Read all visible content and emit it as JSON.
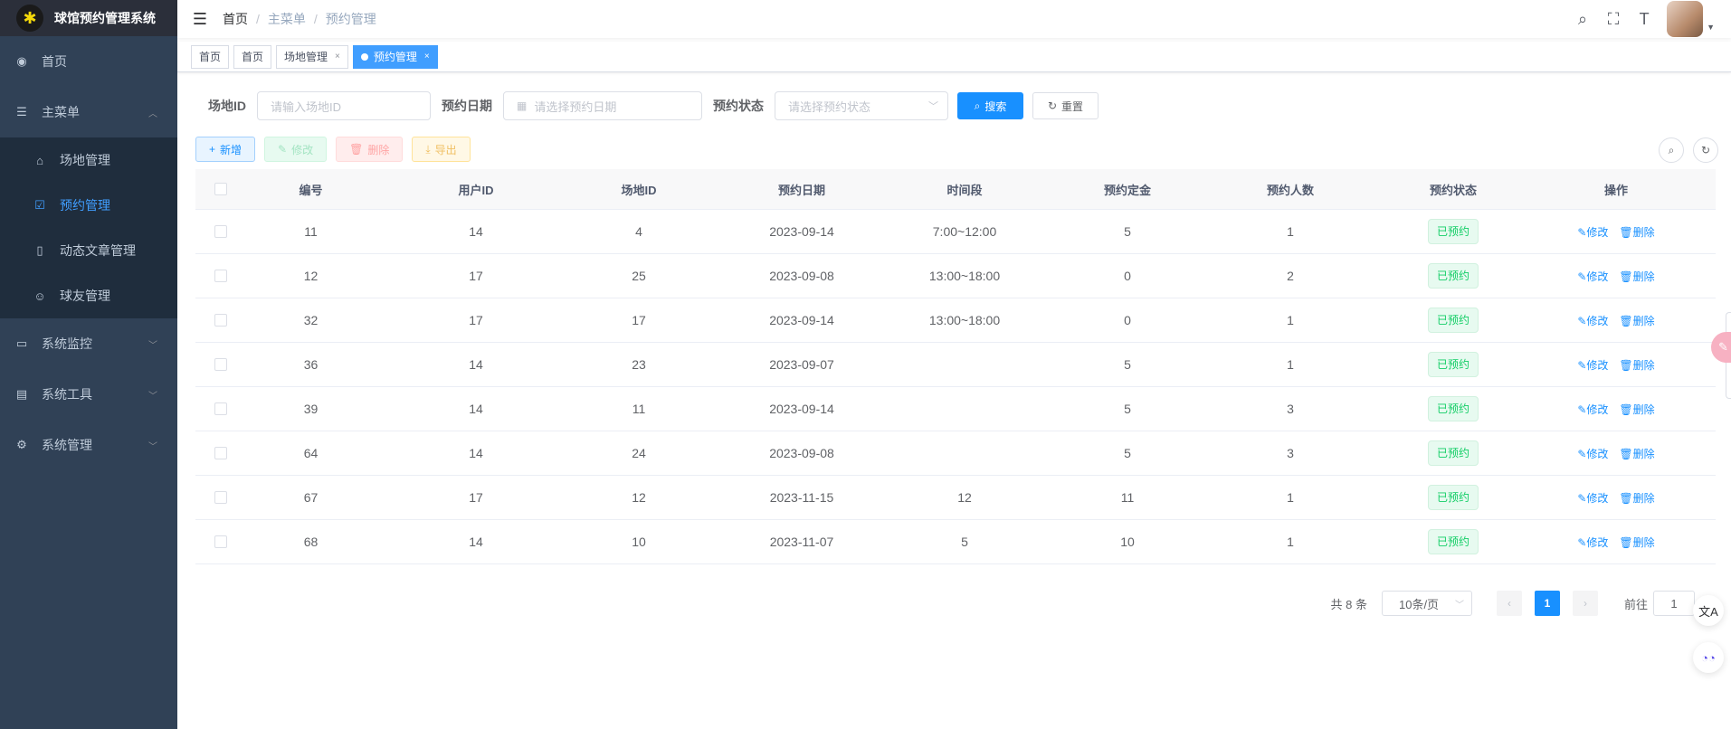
{
  "app": {
    "title": "球馆预约管理系统",
    "logo_icon": "ball-logo"
  },
  "sidebar": {
    "items": [
      {
        "label": "首页",
        "icon": "dashboard-icon"
      },
      {
        "label": "主菜单",
        "icon": "list-icon"
      },
      {
        "label": "系统监控",
        "icon": "monitor-icon"
      },
      {
        "label": "系统工具",
        "icon": "toolbox-icon"
      },
      {
        "label": "系统管理",
        "icon": "gear-icon"
      }
    ],
    "submenu": [
      {
        "label": "场地管理",
        "icon": "field-icon"
      },
      {
        "label": "预约管理",
        "icon": "checkbox-icon"
      },
      {
        "label": "动态文章管理",
        "icon": "book-icon"
      },
      {
        "label": "球友管理",
        "icon": "user-icon"
      }
    ]
  },
  "breadcrumb": [
    "首页",
    "主菜单",
    "预约管理"
  ],
  "tags": [
    {
      "label": "首页"
    },
    {
      "label": "首页"
    },
    {
      "label": "场地管理"
    },
    {
      "label": "预约管理"
    }
  ],
  "search": {
    "field_label": "场地ID",
    "field_placeholder": "请输入场地ID",
    "date_label": "预约日期",
    "date_placeholder": "请选择预约日期",
    "status_label": "预约状态",
    "status_placeholder": "请选择预约状态",
    "search_btn": "搜索",
    "reset_btn": "重置"
  },
  "toolbar": {
    "add": "新增",
    "edit": "修改",
    "delete": "删除",
    "export": "导出"
  },
  "table": {
    "headers": [
      "编号",
      "用户ID",
      "场地ID",
      "预约日期",
      "时间段",
      "预约定金",
      "预约人数",
      "预约状态",
      "操作"
    ],
    "rows": [
      {
        "id": "11",
        "user": "14",
        "field": "4",
        "date": "2023-09-14",
        "time": "7:00~12:00",
        "deposit": "5",
        "people": "1",
        "status": "已预约"
      },
      {
        "id": "12",
        "user": "17",
        "field": "25",
        "date": "2023-09-08",
        "time": "13:00~18:00",
        "deposit": "0",
        "people": "2",
        "status": "已预约"
      },
      {
        "id": "32",
        "user": "17",
        "field": "17",
        "date": "2023-09-14",
        "time": "13:00~18:00",
        "deposit": "0",
        "people": "1",
        "status": "已预约"
      },
      {
        "id": "36",
        "user": "14",
        "field": "23",
        "date": "2023-09-07",
        "time": "",
        "deposit": "5",
        "people": "1",
        "status": "已预约"
      },
      {
        "id": "39",
        "user": "14",
        "field": "11",
        "date": "2023-09-14",
        "time": "",
        "deposit": "5",
        "people": "3",
        "status": "已预约"
      },
      {
        "id": "64",
        "user": "14",
        "field": "24",
        "date": "2023-09-08",
        "time": "",
        "deposit": "5",
        "people": "3",
        "status": "已预约"
      },
      {
        "id": "67",
        "user": "17",
        "field": "12",
        "date": "2023-11-15",
        "time": "12",
        "deposit": "11",
        "people": "1",
        "status": "已预约"
      },
      {
        "id": "68",
        "user": "14",
        "field": "10",
        "date": "2023-11-07",
        "time": "5",
        "deposit": "10",
        "people": "1",
        "status": "已预约"
      }
    ],
    "op_edit": "修改",
    "op_delete": "删除"
  },
  "pagination": {
    "total": "共 8 条",
    "page_size": "10条/页",
    "current": "1",
    "goto_label": "前往",
    "goto_value": "1"
  },
  "colors": {
    "sidebar_bg": "#304156",
    "primary": "#1890ff",
    "success": "#13ce66"
  }
}
